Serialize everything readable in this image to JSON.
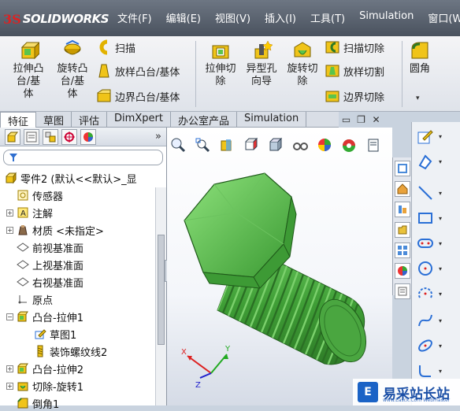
{
  "app": {
    "logo_mark": "3S",
    "logo_text": "SOLIDWORKS"
  },
  "menu": [
    "文件(F)",
    "编辑(E)",
    "视图(V)",
    "插入(I)",
    "工具(T)",
    "Simulation",
    "窗口(W"
  ],
  "ribbon": {
    "extrude_boss": "拉伸凸\n台/基\n体",
    "revolve_boss": "旋转凸\n台/基\n体",
    "sweep": "扫描",
    "loft": "放样凸台/基体",
    "boundary": "边界凸台/基体",
    "extrude_cut": "拉伸切\n除",
    "hole_wizard": "异型孔\n向导",
    "revolve_cut": "旋转切\n除",
    "swept_cut": "扫描切除",
    "lofted_cut": "放样切割",
    "boundary_cut": "边界切除",
    "fillet": "圆角"
  },
  "tabs": [
    "特征",
    "草图",
    "评估",
    "DimXpert",
    "办公室产品",
    "Simulation"
  ],
  "tree": {
    "root": "零件2 (默认<<默认>_显",
    "items": [
      {
        "label": "传感器",
        "icon": "sensor-icon",
        "exp": ""
      },
      {
        "label": "注解",
        "icon": "annotation-icon",
        "exp": "+"
      },
      {
        "label": "材质 <未指定>",
        "icon": "material-icon",
        "exp": "+"
      },
      {
        "label": "前视基准面",
        "icon": "plane-icon",
        "exp": ""
      },
      {
        "label": "上视基准面",
        "icon": "plane-icon",
        "exp": ""
      },
      {
        "label": "右视基准面",
        "icon": "plane-icon",
        "exp": ""
      },
      {
        "label": "原点",
        "icon": "origin-icon",
        "exp": ""
      },
      {
        "label": "凸台-拉伸1",
        "icon": "extrude-icon",
        "exp": "−"
      },
      {
        "label": "草图1",
        "icon": "sketch-icon",
        "exp": ""
      },
      {
        "label": "装饰螺纹线2",
        "icon": "thread-icon",
        "exp": ""
      },
      {
        "label": "凸台-拉伸2",
        "icon": "extrude-icon",
        "exp": "+"
      },
      {
        "label": "切除-旋转1",
        "icon": "cut-icon",
        "exp": "+"
      },
      {
        "label": "倒角1",
        "icon": "chamfer-icon",
        "exp": ""
      }
    ]
  },
  "triad": {
    "x": "X",
    "y": "Y",
    "z": "Z"
  },
  "watermark": {
    "logo": "E",
    "text": "易采站长站",
    "url": "www.Easck.Com Webmaster"
  },
  "colors": {
    "part_green": "#55c24a",
    "menubar": "#5a626e"
  }
}
